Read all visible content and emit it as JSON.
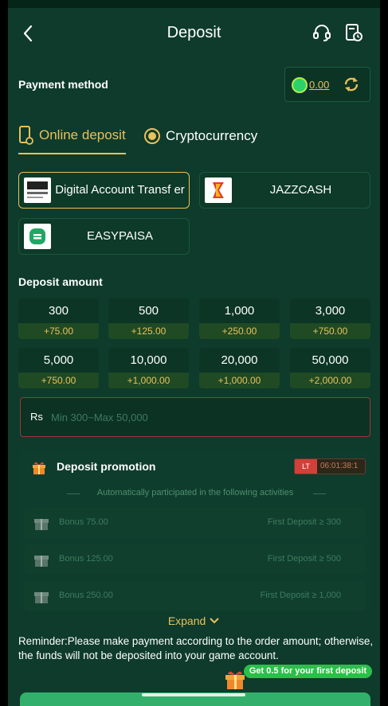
{
  "header": {
    "title": "Deposit",
    "back_icon": "chevron-left-icon",
    "support_icon": "headset-icon",
    "history_icon": "clock-document-icon"
  },
  "payment": {
    "label": "Payment method",
    "balance": "0.00",
    "balance_icon": "wallet-coin-icon",
    "refresh_icon": "refresh-icon"
  },
  "tabs": [
    {
      "label": "Online deposit",
      "icon": "phone-icon",
      "active": true
    },
    {
      "label": "Cryptocurrency",
      "icon": "coin-icon",
      "active": false
    }
  ],
  "methods": [
    {
      "name": "Digital Account Transf er",
      "logo": "digital-account-logo",
      "selected": true
    },
    {
      "name": "JAZZCASH",
      "logo": "jazzcash-logo",
      "selected": false
    },
    {
      "name": "EASYPAISA",
      "logo": "easypaisa-logo",
      "selected": false
    }
  ],
  "deposit_amount": {
    "label": "Deposit amount",
    "options": [
      {
        "amount": "300",
        "bonus": "+75.00"
      },
      {
        "amount": "500",
        "bonus": "+125.00"
      },
      {
        "amount": "1,000",
        "bonus": "+250.00"
      },
      {
        "amount": "3,000",
        "bonus": "+750.00"
      },
      {
        "amount": "5,000",
        "bonus": "+750.00"
      },
      {
        "amount": "10,000",
        "bonus": "+1,000.00"
      },
      {
        "amount": "20,000",
        "bonus": "+1,000.00"
      },
      {
        "amount": "50,000",
        "bonus": "+2,000.00"
      }
    ],
    "currency": "Rs",
    "placeholder": "Min 300~Max 50,000",
    "value": ""
  },
  "promotion": {
    "title": "Deposit promotion",
    "icon": "gift-icon",
    "timer_tag": "LT",
    "timer": "06:01:38:1",
    "auto_text": "Automatically participated in the following activities",
    "rows": [
      {
        "bonus": "Bonus 75.00",
        "condition": "First Deposit ≥ 300"
      },
      {
        "bonus": "Bonus 125.00",
        "condition": "First Deposit ≥ 500"
      },
      {
        "bonus": "Bonus 250.00",
        "condition": "First Deposit ≥ 1,000"
      }
    ]
  },
  "expand_label": "Expand",
  "reminder": "Reminder:Please make payment according to the order amount; otherwise, the funds will not be deposited into your game account.",
  "first_deposit_badge": "Get 0.5 for your first deposit",
  "colors": {
    "background": "#0e3b2b",
    "accent": "#e9c15a",
    "error_border": "#a5333a",
    "badge_green": "#2bbf4a"
  }
}
